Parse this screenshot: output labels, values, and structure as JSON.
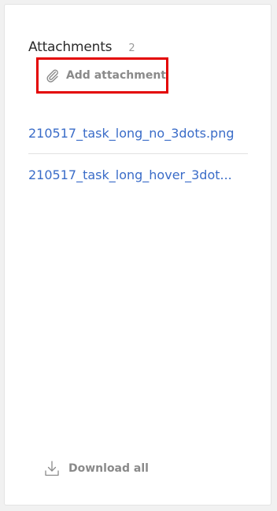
{
  "attachments": {
    "title": "Attachments",
    "count": "2",
    "add_label": "Add attachment",
    "add_icon": "paperclip-icon",
    "highlight_color": "#e30000",
    "link_color": "#3a6cc8",
    "files": [
      {
        "name": "210517_task_long_no_3dots.png"
      },
      {
        "name": "210517_task_long_hover_3dot..."
      }
    ],
    "download_label": "Download all",
    "download_icon": "download-icon"
  }
}
